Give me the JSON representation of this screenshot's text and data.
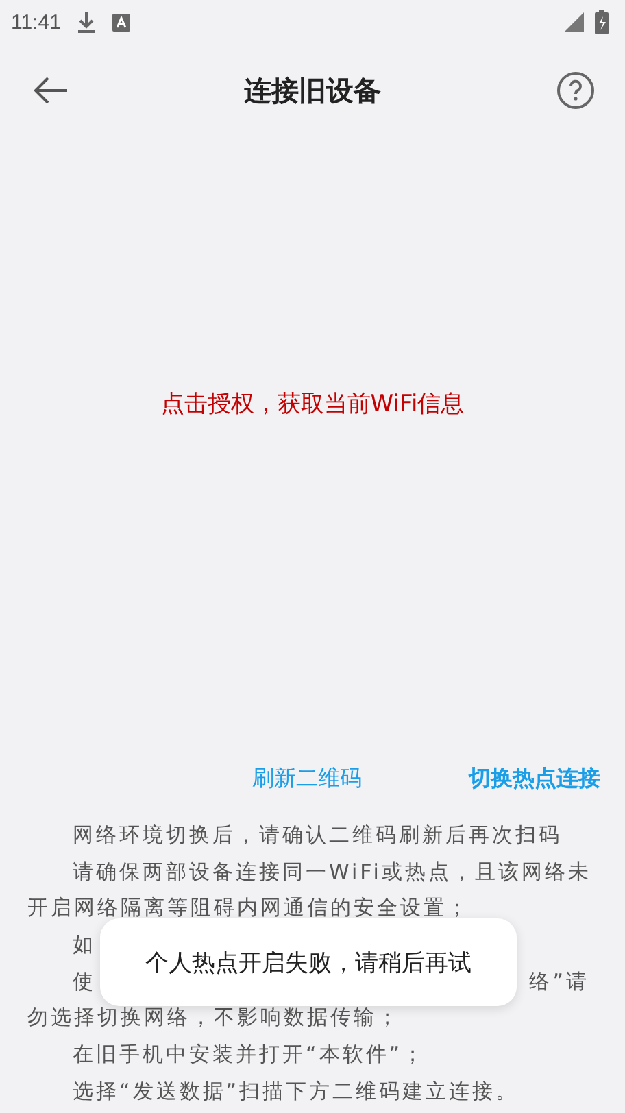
{
  "status_bar": {
    "time": "11:41"
  },
  "header": {
    "title": "连接旧设备"
  },
  "prompt": "点击授权，获取当前WiFi信息",
  "actions": [
    {
      "label": "刷新二维码"
    },
    {
      "label": "切换热点连接"
    }
  ],
  "instruction_lines": [
    {
      "indent": true,
      "text": "网络环境切换后，请确认二维码刷新后再次扫码"
    },
    {
      "indent": true,
      "text": "请确保两部设备连接同一WiFi或热点，且该网络未"
    },
    {
      "indent": false,
      "text": "开启网络隔离等阻碍内网通信的安全设置；"
    },
    {
      "indent": true,
      "text": "如"
    },
    {
      "indent": true,
      "text": "使",
      "tail": "络”请"
    },
    {
      "indent": false,
      "text": "勿选择切换网络，不影响数据传输；"
    },
    {
      "indent": true,
      "text": "在旧手机中安装并打开“本软件”；"
    },
    {
      "indent": true,
      "text": "选择“发送数据”扫描下方二维码建立连接。"
    }
  ],
  "toast": "个人热点开启失败，请稍后再试"
}
